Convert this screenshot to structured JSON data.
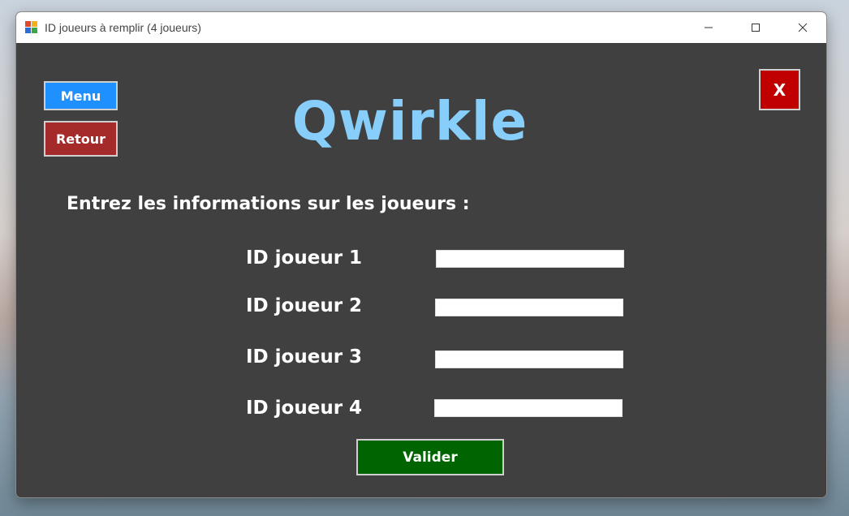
{
  "window": {
    "title": "ID joueurs à remplir (4 joueurs)",
    "controls": [
      "minimize-icon",
      "maximize-icon",
      "close-icon"
    ]
  },
  "nav": {
    "menu_label": "Menu",
    "back_label": "Retour",
    "close_label": "X"
  },
  "logo": "Qwirkle",
  "prompt": "Entrez les informations sur les joueurs :",
  "players": [
    {
      "label": "ID joueur 1",
      "value": ""
    },
    {
      "label": "ID joueur 2",
      "value": ""
    },
    {
      "label": "ID joueur 3",
      "value": ""
    },
    {
      "label": "ID joueur 4",
      "value": ""
    }
  ],
  "submit_label": "Valider",
  "colors": {
    "background": "#404040",
    "menu": "#1e90ff",
    "back": "#a52a2a",
    "close": "#c00000",
    "submit": "#006400",
    "logo": "#87cefa"
  }
}
